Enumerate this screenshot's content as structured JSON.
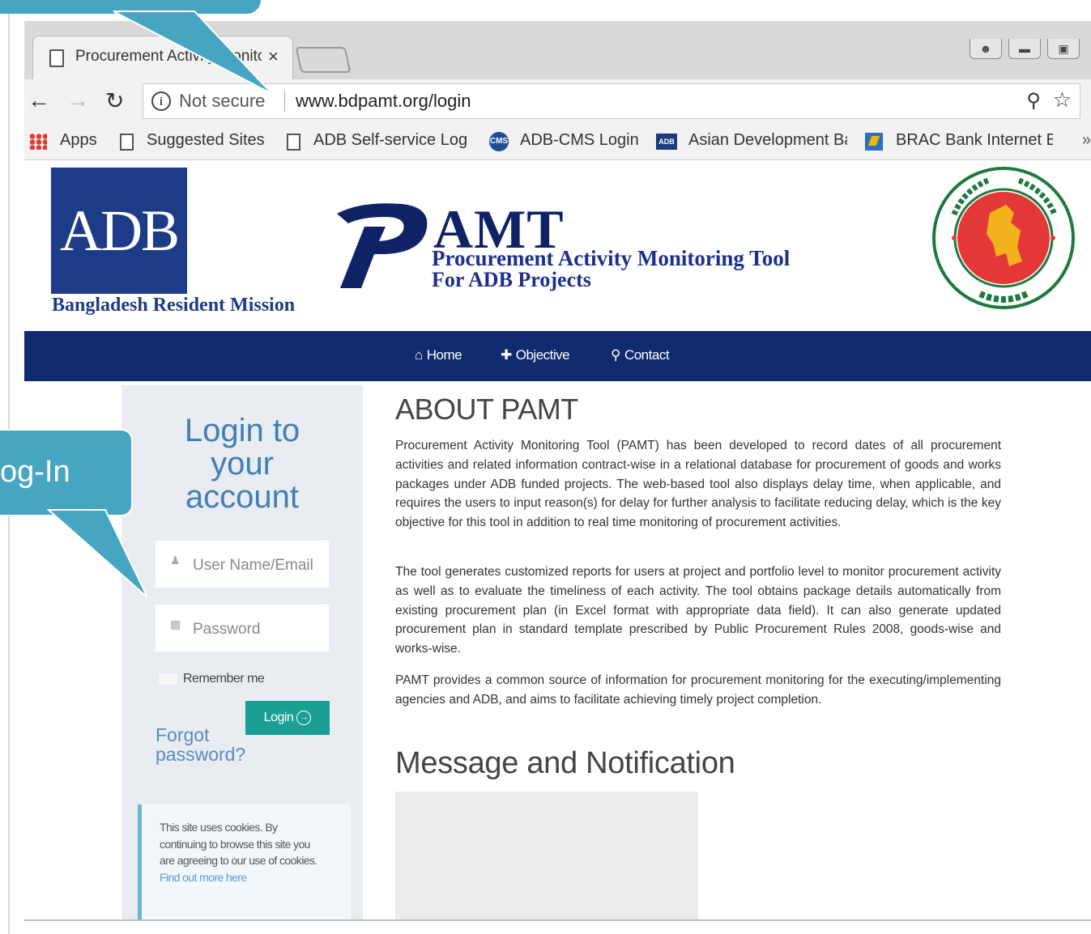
{
  "browser": {
    "tab_title": "Procurement Activity Monitoring Tool",
    "tab_close": "×",
    "security_label": "Not secure",
    "url": "www.bdpamt.org/login",
    "bookmarks": {
      "apps": "Apps",
      "suggested": "Suggested Sites",
      "adb_self": "ADB Self-service Login",
      "adb_cms": "ADB-CMS Login",
      "asian_dev": "Asian Development Bank",
      "brac": "BRAC Bank Internet Banking",
      "more": "»"
    }
  },
  "header": {
    "adb_logo_text": "ADB",
    "mission": "Bangladesh Resident Mission",
    "pamt_title": "AMT",
    "pamt_line1": "Procurement Activity Monitoring Tool",
    "pamt_line2": "For ADB Projects"
  },
  "nav": {
    "home": "Home",
    "objective": "Objective",
    "contact": "Contact"
  },
  "login": {
    "title_l1": "Login to",
    "title_l2": "your",
    "title_l3": "account",
    "username_placeholder": "User Name/Email",
    "password_placeholder": "Password",
    "remember": "Remember me",
    "login_button": "Login",
    "forgot": "Forgot password?",
    "cookie_text": "This site uses cookies. By continuing to browse this site you are agreeing to our use of cookies.",
    "cookie_link": "Find out more here"
  },
  "main": {
    "about_title": "ABOUT PAMT",
    "para1": "Procurement Activity Monitoring Tool (PAMT) has been developed to record dates of all procurement activities and related information contract-wise in a relational database for procurement of goods and works packages under ADB funded projects. The web-based tool also displays delay time, when applicable, and requires the users to input reason(s) for delay for further analysis to facilitate reducing delay, which is the key objective for this tool in addition to real time monitoring of procurement activities.",
    "para2": "The tool generates customized reports for users at project and portfolio level to monitor procurement activity as well as to evaluate the timeliness of each activity. The tool obtains package details automatically from existing procurement plan (in Excel format with appropriate data field). It can also generate updated procurement plan in standard template prescribed by Public Procurement Rules 2008, goods-wise and works-wise.",
    "para3": "PAMT provides a common source of information for procurement monitoring for the executing/implementing agencies and ADB, and aims to facilitate achieving timely project completion.",
    "message_title": "Message and Notification"
  },
  "callouts": {
    "left_text": "og-In"
  },
  "colors": {
    "navbar": "#0f2a6e",
    "login_button": "#199f94",
    "callout": "#46a6c1",
    "adb_blue": "#1d3b86"
  }
}
